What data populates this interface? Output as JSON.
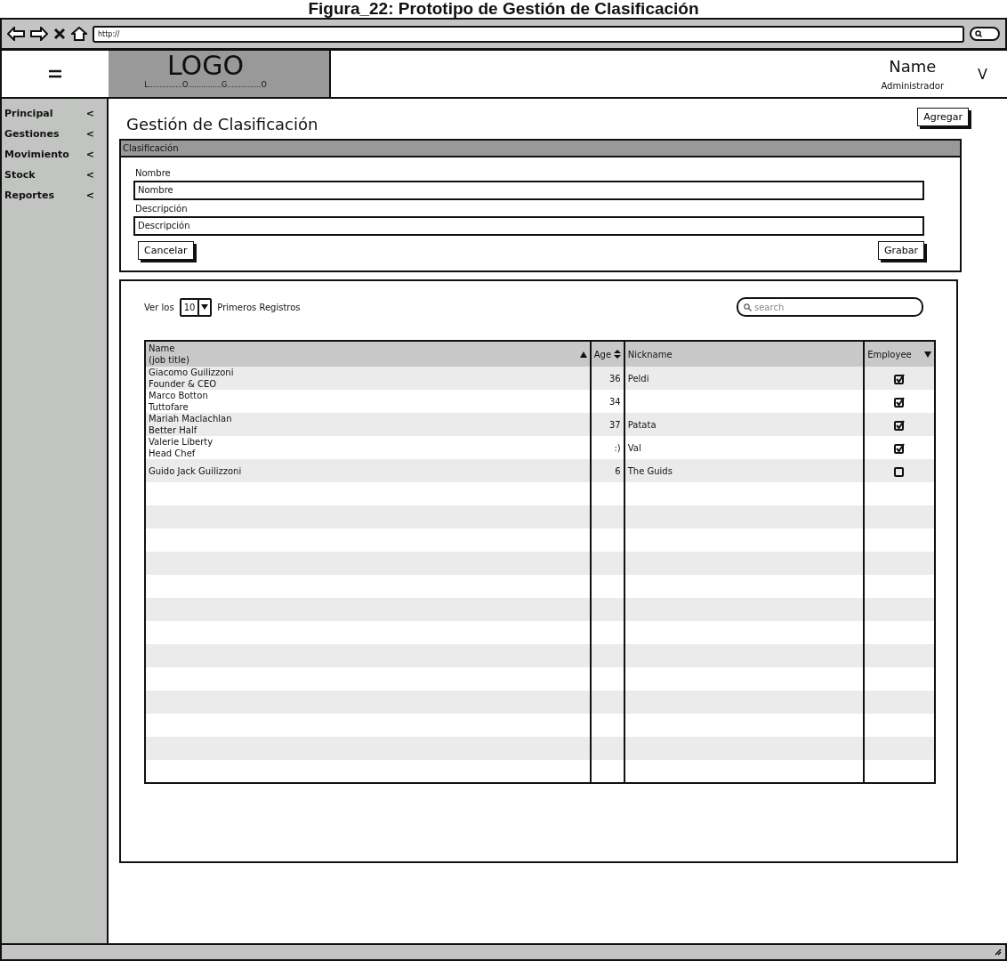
{
  "caption": "Figura_22: Prototipo  de Gestión de Clasificación",
  "browser": {
    "url": "http://"
  },
  "header": {
    "logo": "LOGO",
    "logo_sub": "L...............O...............G...............O",
    "user_name": "Name",
    "user_role": "Administrador",
    "user_menu": "V"
  },
  "sidebar": {
    "items": [
      {
        "label": "Principal",
        "arrow": "<"
      },
      {
        "label": "Gestiones",
        "arrow": "<"
      },
      {
        "label": "Movimiento",
        "arrow": "<"
      },
      {
        "label": "Stock",
        "arrow": "<"
      },
      {
        "label": "Reportes",
        "arrow": "<"
      }
    ]
  },
  "page": {
    "title": "Gestión de Clasificación",
    "add_button": "Agregar"
  },
  "form": {
    "header": "Clasificación",
    "fields": [
      {
        "label": "Nombre",
        "value": "Nombre"
      },
      {
        "label": "Descripción",
        "value": "Descripción"
      }
    ],
    "cancel": "Cancelar",
    "save": "Grabar"
  },
  "list": {
    "show_prefix": "Ver los",
    "page_size": "10",
    "show_suffix": "Primeros Registros",
    "search_placeholder": "search",
    "columns": [
      {
        "lines": [
          "Name",
          "(job title)"
        ],
        "kind": "ascending"
      },
      {
        "lines": [
          "Age"
        ],
        "kind": "sortable"
      },
      {
        "lines": [
          "Nickname"
        ],
        "kind": "plain"
      },
      {
        "lines": [
          "Employee"
        ],
        "kind": "descending"
      }
    ],
    "rows": [
      {
        "name": "Giacomo Guilizzoni",
        "title": "Founder & CEO",
        "age": "36",
        "nickname": "Peldi",
        "employee": true
      },
      {
        "name": "Marco Botton",
        "title": "Tuttofare",
        "age": "34",
        "employee": true
      },
      {
        "name": "Mariah Maclachlan",
        "title": "Better Half",
        "age": "37",
        "nickname": "Patata",
        "employee": true
      },
      {
        "name": "Valerie Liberty",
        "title": "Head Chef",
        "age": ":)",
        "nickname": "Val",
        "employee": true
      },
      {
        "name": "Guido Jack Guilizzoni",
        "age": "6",
        "nickname": "The Guids",
        "employee": false
      }
    ]
  }
}
